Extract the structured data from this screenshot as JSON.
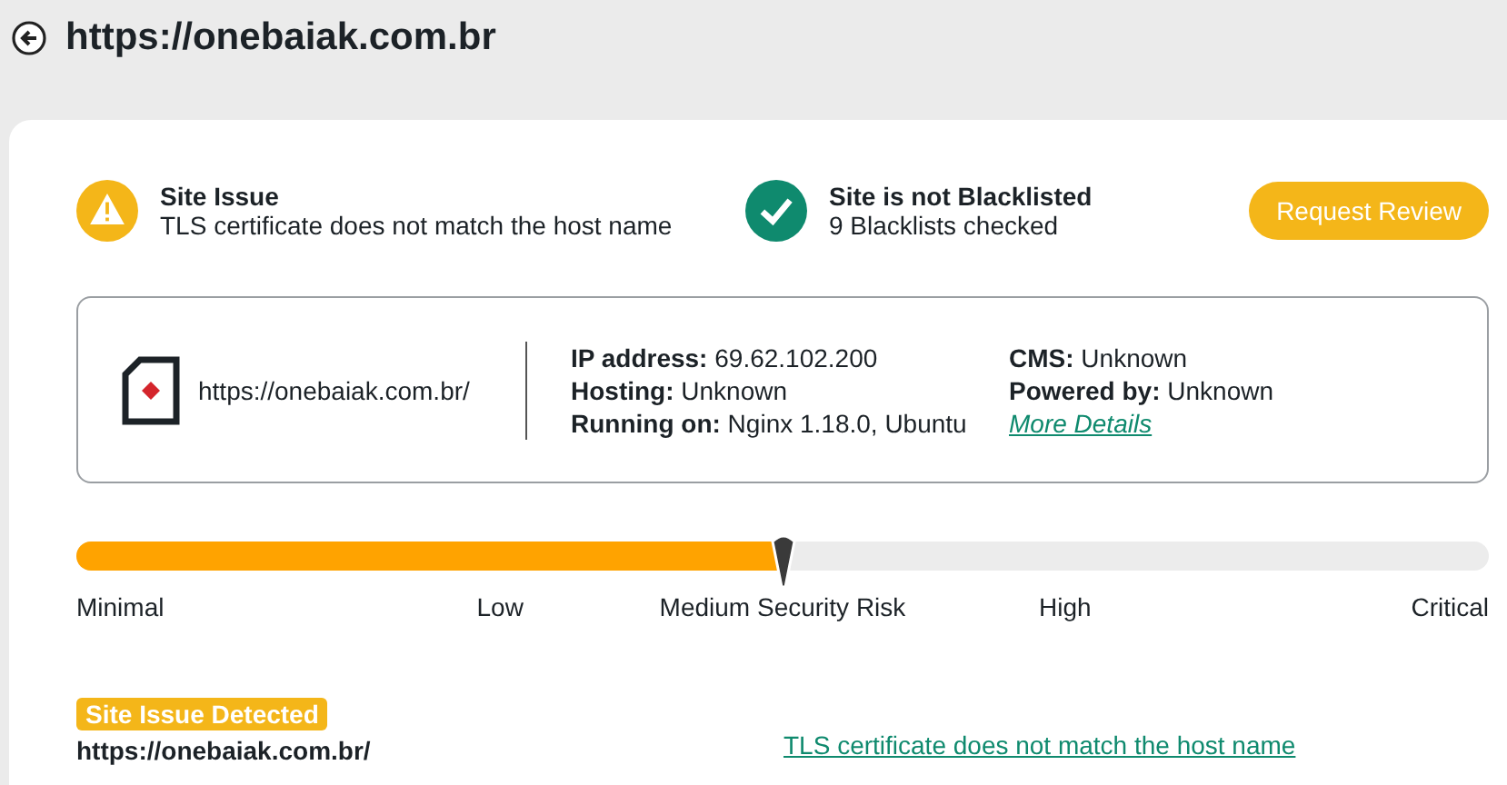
{
  "header": {
    "title": "https://onebaiak.com.br"
  },
  "status": [
    {
      "kind": "warning",
      "title": "Site Issue",
      "detail": "TLS certificate does not match the host name"
    },
    {
      "kind": "ok",
      "title": "Site is not Blacklisted",
      "detail": "9 Blacklists checked"
    }
  ],
  "request_button": "Request Review",
  "site_info": {
    "url": "https://onebaiak.com.br/",
    "details_left": [
      {
        "label": "IP address:",
        "value": "69.62.102.200"
      },
      {
        "label": "Hosting:",
        "value": "Unknown"
      },
      {
        "label": "Running on:",
        "value": "Nginx 1.18.0, Ubuntu"
      }
    ],
    "details_right": [
      {
        "label": "CMS:",
        "value": "Unknown"
      },
      {
        "label": "Powered by:",
        "value": "Unknown"
      }
    ],
    "more_link": "More Details"
  },
  "risk": {
    "level": 0.5,
    "labels": [
      "Minimal",
      "Low",
      "Medium Security Risk",
      "High",
      "Critical"
    ]
  },
  "issue": {
    "badge": "Site Issue Detected",
    "url": "https://onebaiak.com.br/",
    "link": "TLS certificate does not match the host name"
  }
}
